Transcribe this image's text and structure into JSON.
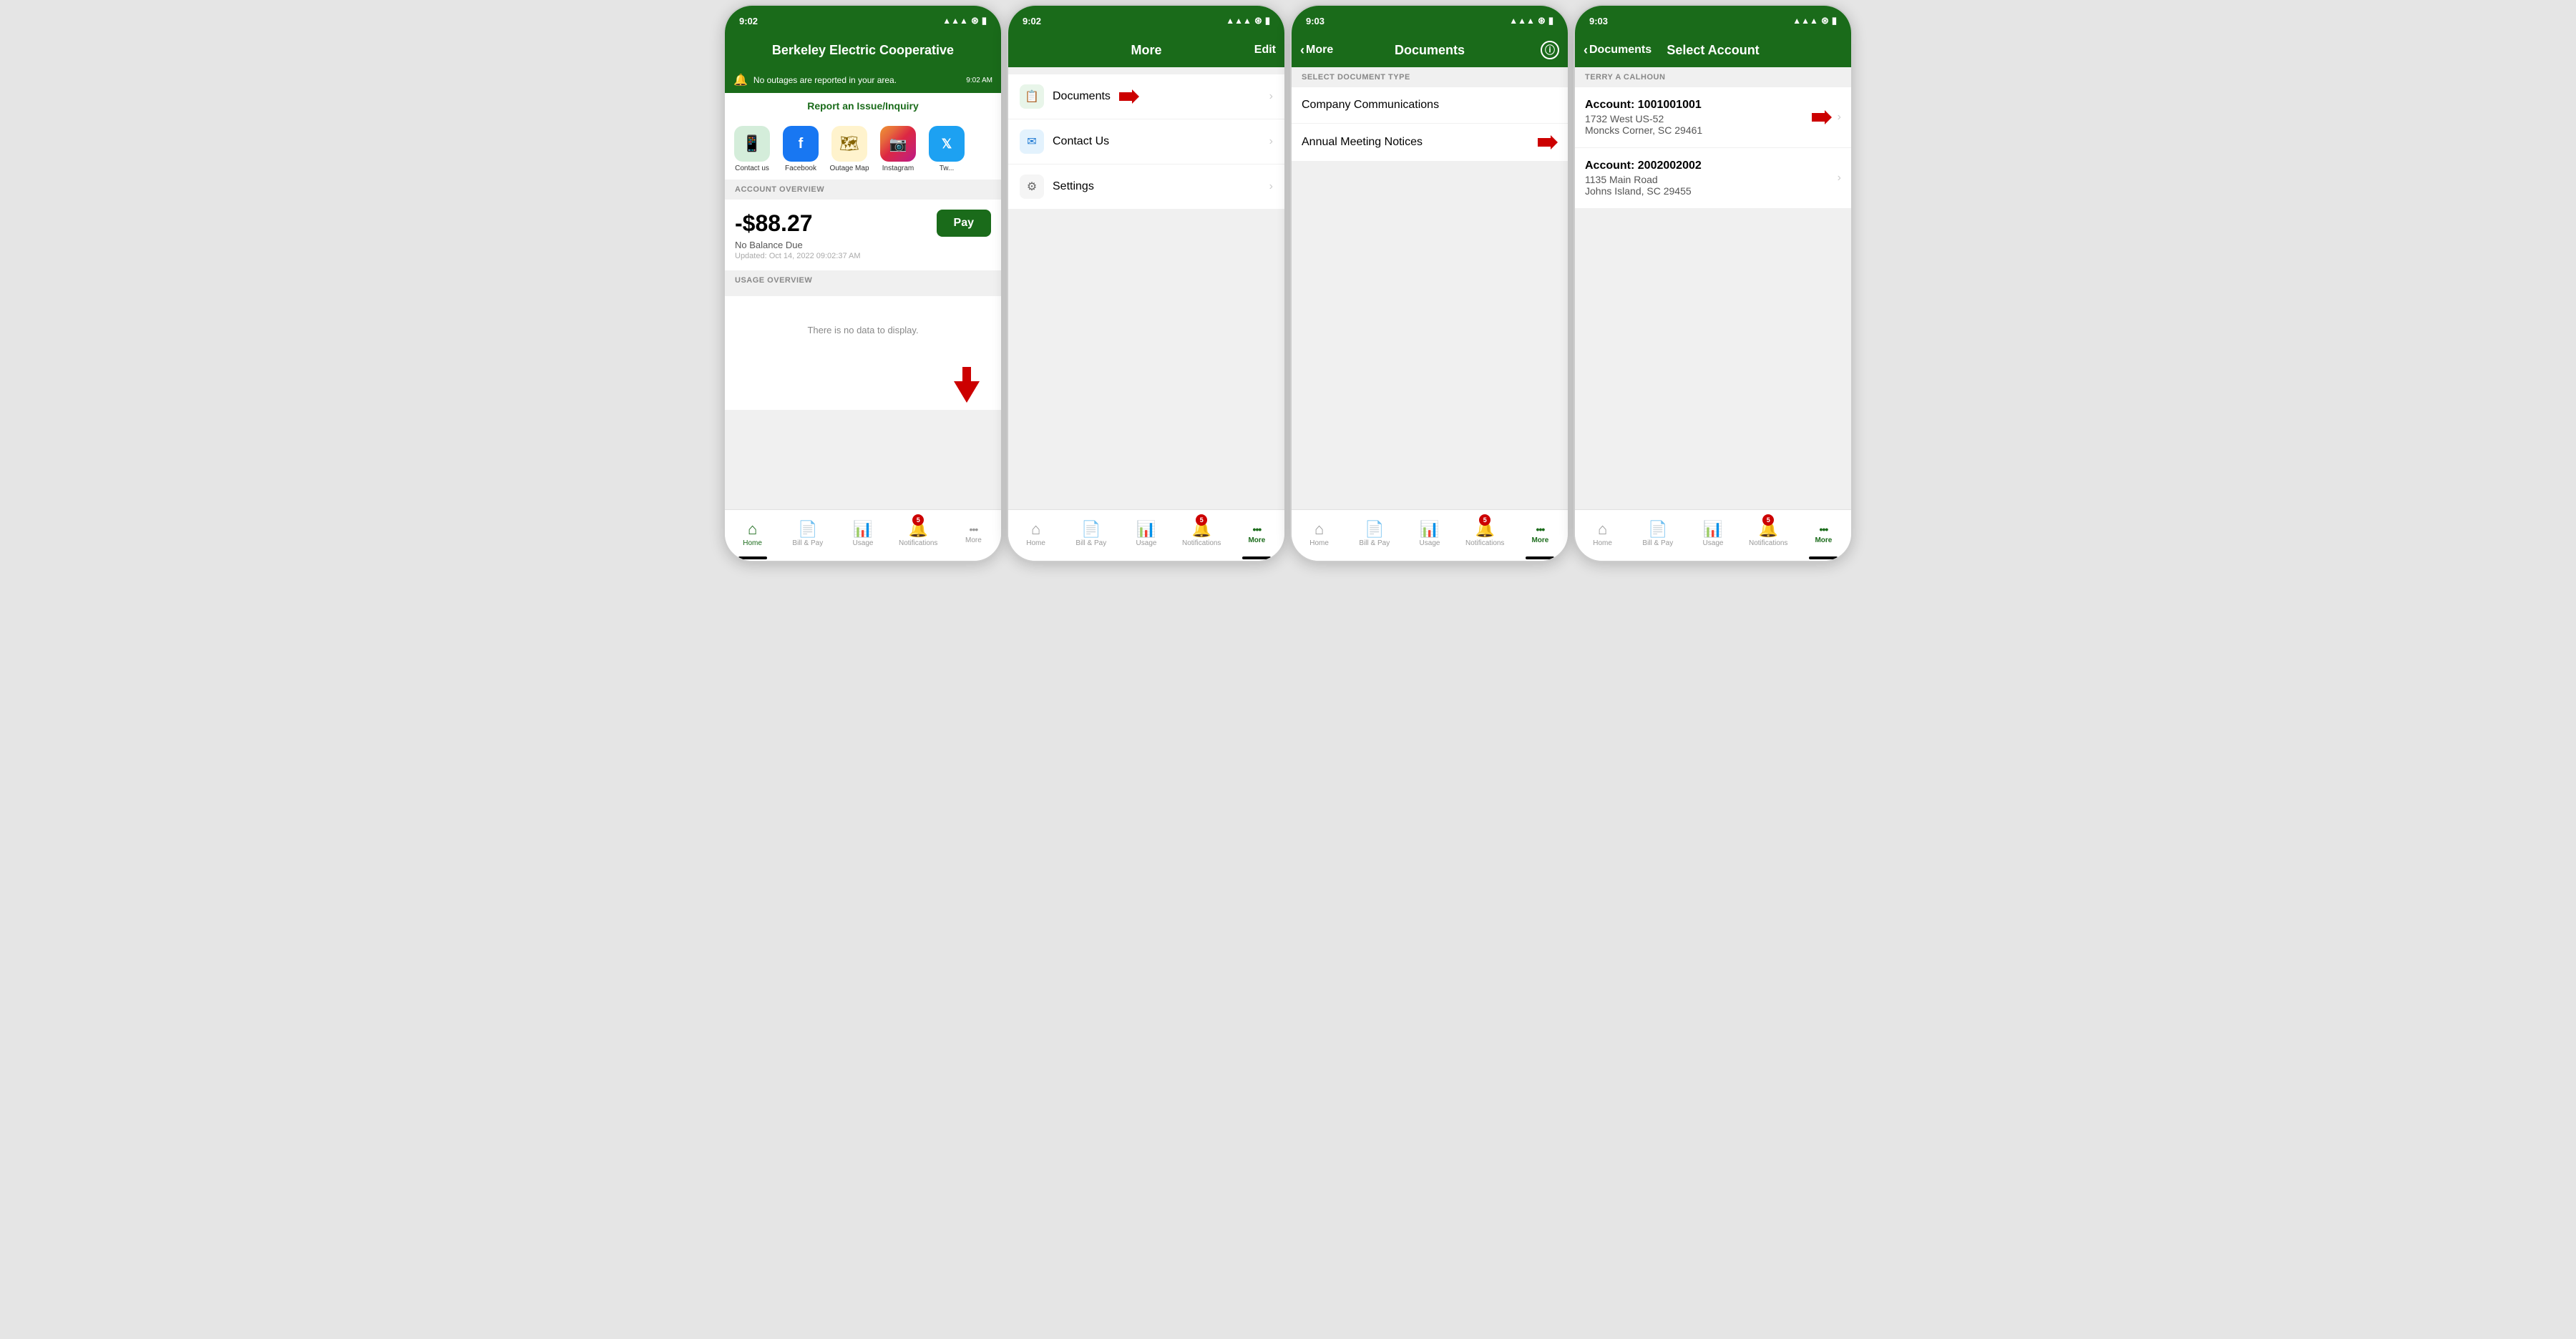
{
  "screen1": {
    "status_time": "9:02",
    "header_title": "Berkeley Electric Cooperative",
    "notification_text": "No outages are reported in your area.",
    "notification_time": "9:02 AM",
    "report_link": "Report an Issue/Inquiry",
    "quick_links": [
      {
        "label": "Contact us",
        "icon": "📱",
        "type": "green"
      },
      {
        "label": "Facebook",
        "icon": "f",
        "type": "facebook"
      },
      {
        "label": "Outage Map",
        "icon": "🗺",
        "type": "map"
      },
      {
        "label": "Instagram",
        "icon": "📷",
        "type": "instagram"
      },
      {
        "label": "Tw...",
        "icon": "t",
        "type": "twitter"
      }
    ],
    "account_overview_label": "ACCOUNT OVERVIEW",
    "balance": "-$88.27",
    "pay_label": "Pay",
    "balance_status": "No Balance Due",
    "balance_updated": "Updated: Oct 14, 2022 09:02:37 AM",
    "usage_overview_label": "USAGE OVERVIEW",
    "no_data_text": "There is no data to display.",
    "tabs": [
      {
        "label": "Home",
        "active": true
      },
      {
        "label": "Bill & Pay"
      },
      {
        "label": "Usage"
      },
      {
        "label": "Notifications",
        "badge": "5"
      },
      {
        "label": "More"
      }
    ]
  },
  "screen2": {
    "status_time": "9:02",
    "header_title": "More",
    "header_edit": "Edit",
    "menu_items": [
      {
        "label": "Documents",
        "icon": "doc",
        "arrow": true
      },
      {
        "label": "Contact Us",
        "icon": "contact",
        "arrow": true
      },
      {
        "label": "Settings",
        "icon": "settings",
        "arrow": true
      }
    ],
    "tabs": [
      {
        "label": "Home"
      },
      {
        "label": "Bill & Pay"
      },
      {
        "label": "Usage"
      },
      {
        "label": "Notifications",
        "badge": "5"
      },
      {
        "label": "More",
        "active": true
      }
    ]
  },
  "screen3": {
    "status_time": "9:03",
    "header_title": "Documents",
    "header_back": "More",
    "header_info": "i",
    "section_label": "SELECT DOCUMENT TYPE",
    "doc_items": [
      {
        "label": "Company Communications"
      },
      {
        "label": "Annual Meeting Notices"
      }
    ],
    "tabs": [
      {
        "label": "Home"
      },
      {
        "label": "Bill & Pay"
      },
      {
        "label": "Usage"
      },
      {
        "label": "Notifications",
        "badge": "5"
      },
      {
        "label": "More",
        "active": true
      }
    ]
  },
  "screen4": {
    "status_time": "9:03",
    "header_title": "Select Account",
    "header_back": "Documents",
    "section_label": "TERRY A CALHOUN",
    "accounts": [
      {
        "number": "Account: 1001001001",
        "address": "1732 West US-52",
        "city": "Moncks Corner, SC 29461",
        "arrow": true
      },
      {
        "number": "Account: 2002002002",
        "address": "1135 Main Road",
        "city": "Johns Island, SC 29455",
        "arrow": true
      }
    ],
    "tabs": [
      {
        "label": "Home"
      },
      {
        "label": "Bill & Pay"
      },
      {
        "label": "Usage"
      },
      {
        "label": "Notifications",
        "badge": "5"
      },
      {
        "label": "More",
        "active": true
      }
    ]
  }
}
